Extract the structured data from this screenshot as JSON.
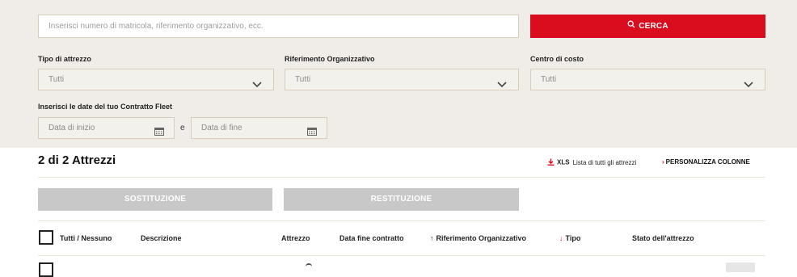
{
  "search": {
    "placeholder": "Inserisci numero di matricola, riferimento organizzativo, ecc.",
    "button_label": "CERCA"
  },
  "filters": {
    "tool_type": {
      "label": "Tipo di attrezzo",
      "value": "Tutti"
    },
    "org_reference": {
      "label": "Riferimento Organizzativo",
      "value": "Tutti"
    },
    "cost_center": {
      "label": "Centro di costo",
      "value": "Tutti"
    }
  },
  "contract_dates": {
    "label": "Inserisci le date del tuo Contratto Fleet",
    "start_placeholder": "Data di inizio",
    "separator": "e",
    "end_placeholder": "Data di fine"
  },
  "results": {
    "title": "2 di 2 Attrezzi",
    "xls_label": "XLS",
    "xls_sublabel": "Lista di tutti gli attrezzi",
    "customize_label": "PERSONALIZZA COLONNE"
  },
  "actions": {
    "replace_label": "SOSTITUZIONE",
    "return_label": "RESTITUZIONE"
  },
  "table": {
    "headers": {
      "select_all": "Tutti / Nessuno",
      "description": "Descrizione",
      "tool": "Attrezzo",
      "contract_end": "Data fine contratto",
      "org_ref": "Riferimento Organizzativo",
      "type": "Tipo",
      "status": "Stato dell'attrezzo"
    }
  },
  "colors": {
    "accent": "#d90d1e",
    "panel_bg": "#f0ede8",
    "disabled_button": "#c8c8c8"
  },
  "icons": {
    "search": "search-icon",
    "chevron": "chevron-down-icon",
    "calendar": "calendar-icon",
    "download": "download-icon",
    "sort_up": "arrow-up-icon",
    "sort_down": "arrow-down-icon"
  }
}
